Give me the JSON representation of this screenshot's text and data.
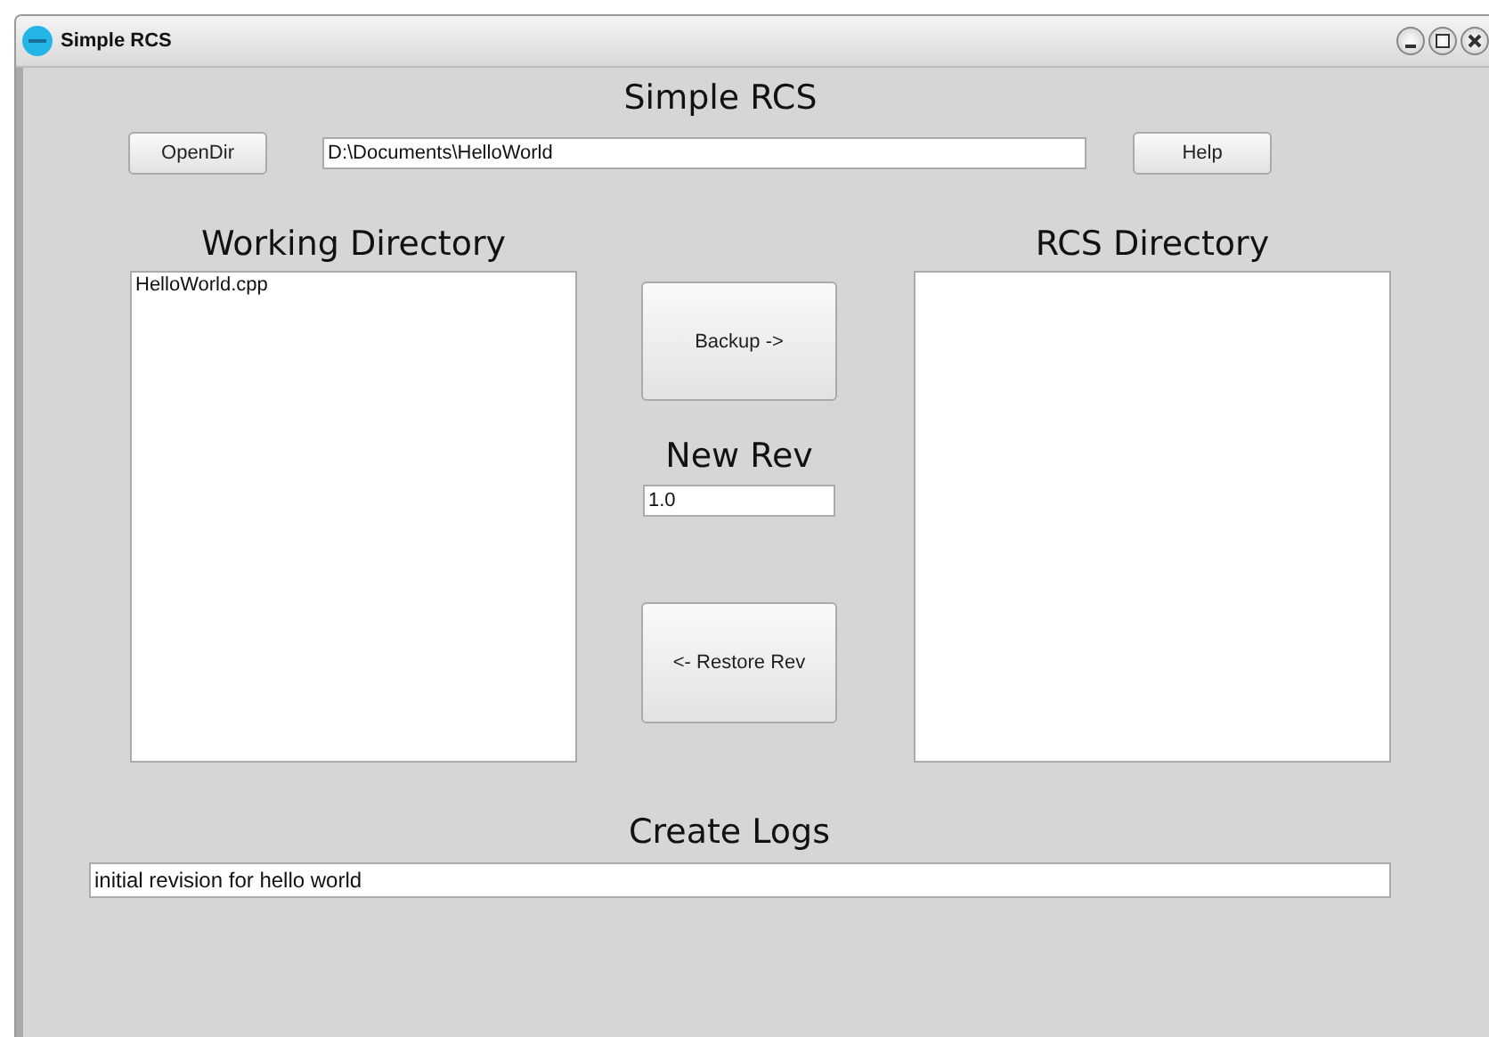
{
  "window": {
    "title": "Simple RCS"
  },
  "heading": "Simple RCS",
  "open_dir_button": "OpenDir",
  "path_field": {
    "value": "D:\\Documents\\HelloWorld"
  },
  "help_button": "Help",
  "working_directory": {
    "title": "Working Directory",
    "items": [
      {
        "label": "HelloWorld.cpp",
        "selected": false
      }
    ]
  },
  "backup_button": "Backup ->",
  "new_rev": {
    "label": "New Rev",
    "value": "1.0"
  },
  "restore_button": "<- Restore Rev",
  "rcs_directory": {
    "title": "RCS Directory"
  },
  "create_logs": {
    "label": "Create Logs",
    "value": "initial revision for hello world"
  }
}
